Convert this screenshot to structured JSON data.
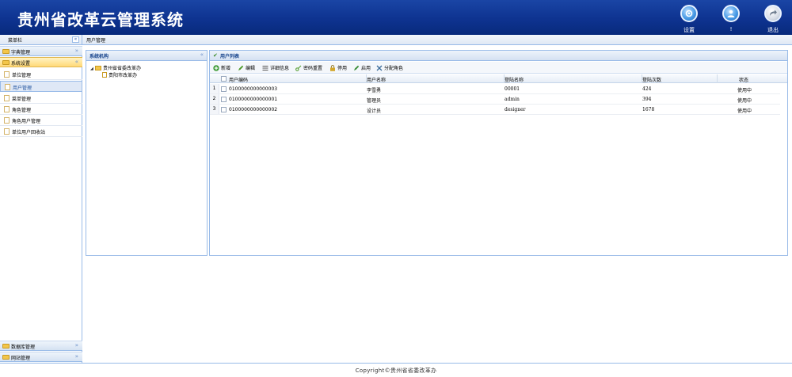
{
  "header": {
    "title": "贵州省改革云管理系统",
    "settings_label": "设置",
    "user_label": "!",
    "exit_label": "退出"
  },
  "subbar": {
    "menu_title": "菜单栏",
    "collapse_symbol": "«",
    "breadcrumb": "用户管理"
  },
  "sidebar": {
    "sections": [
      {
        "label": "字典管理",
        "chevron": "»"
      },
      {
        "label": "系统设置",
        "chevron": "«"
      },
      {
        "label": "数据库管理",
        "chevron": "»"
      },
      {
        "label": "网站管理",
        "chevron": "»"
      }
    ],
    "items": [
      {
        "label": "单位管理"
      },
      {
        "label": "用户管理"
      },
      {
        "label": "菜单管理"
      },
      {
        "label": "角色管理"
      },
      {
        "label": "角色用户管理"
      },
      {
        "label": "单位用户回收站"
      }
    ]
  },
  "org_panel": {
    "title": "系统机构",
    "collapse": "«",
    "tree": [
      {
        "label": "贵州省省委改革办",
        "arrow": "◢"
      },
      {
        "label": "贵阳市改革办"
      }
    ]
  },
  "user_panel": {
    "title": "用户列表",
    "toolbar": [
      {
        "label": "新增",
        "icon": "add-icon"
      },
      {
        "label": "编辑",
        "icon": "edit-icon"
      },
      {
        "label": "详细信息",
        "icon": "list-icon"
      },
      {
        "label": "密码重置",
        "icon": "key-icon"
      },
      {
        "label": "停用",
        "icon": "lock-icon"
      },
      {
        "label": "启用",
        "icon": "unlock-icon"
      },
      {
        "label": "分配角色",
        "icon": "tools-icon"
      }
    ],
    "columns": [
      "用户编码",
      "用户名称",
      "登陆名称",
      "登陆次数",
      "状态"
    ],
    "rows": [
      {
        "num": "1",
        "code": "0100000000000003",
        "name": "李雪勇",
        "login": "00001",
        "count": "424",
        "status": "使用中"
      },
      {
        "num": "2",
        "code": "0100000000000001",
        "name": "管理员",
        "login": "admin",
        "count": "394",
        "status": "使用中"
      },
      {
        "num": "3",
        "code": "0100000000000002",
        "name": "设计员",
        "login": "designer",
        "count": "1678",
        "status": "使用中"
      }
    ]
  },
  "footer": {
    "copyright": "Copyright©贵州省省委改革办"
  },
  "colors": {
    "header_bg": "#0e3390",
    "border": "#99bbe8",
    "active_section": "#ffd978"
  }
}
